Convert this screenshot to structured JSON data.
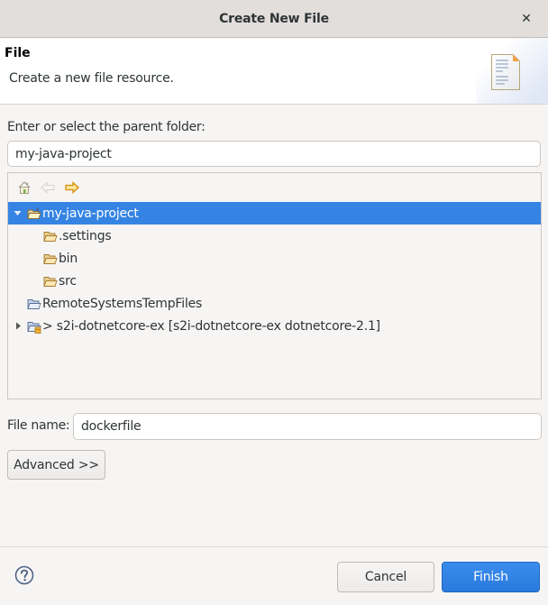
{
  "window": {
    "title": "Create New File",
    "close_icon": "close-icon"
  },
  "banner": {
    "heading": "File",
    "description": "Create a new file resource.",
    "icon": "new-file-icon"
  },
  "parent_folder": {
    "label": "Enter or select the parent folder:",
    "value": "my-java-project"
  },
  "tree_toolbar": {
    "buttons": [
      {
        "name": "home",
        "icon": "home-icon",
        "enabled": true
      },
      {
        "name": "back",
        "icon": "back-arrow-icon",
        "enabled": false
      },
      {
        "name": "forward",
        "icon": "forward-arrow-icon",
        "enabled": true
      }
    ]
  },
  "tree": {
    "items": [
      {
        "label": "my-java-project",
        "level": 0,
        "expanded": true,
        "has_children": true,
        "selected": true,
        "icon": "project-folder-icon"
      },
      {
        "label": ".settings",
        "level": 1,
        "expanded": false,
        "has_children": false,
        "selected": false,
        "icon": "folder-icon"
      },
      {
        "label": "bin",
        "level": 1,
        "expanded": false,
        "has_children": false,
        "selected": false,
        "icon": "folder-icon"
      },
      {
        "label": "src",
        "level": 1,
        "expanded": false,
        "has_children": false,
        "selected": false,
        "icon": "folder-icon"
      },
      {
        "label": "RemoteSystemsTempFiles",
        "level": 0,
        "expanded": false,
        "has_children": false,
        "selected": false,
        "icon": "project-folder-icon"
      },
      {
        "label": "> s2i-dotnetcore-ex [s2i-dotnetcore-ex dotnetcore-2.1]",
        "level": 0,
        "expanded": false,
        "has_children": true,
        "selected": false,
        "icon": "git-project-folder-icon"
      }
    ]
  },
  "file_name": {
    "label": "File name:",
    "value": "dockerfile"
  },
  "buttons": {
    "advanced": "Advanced >>",
    "cancel": "Cancel",
    "finish": "Finish",
    "help_icon": "help-icon"
  },
  "colors": {
    "selection": "#3584e4",
    "primary_button": "#2a79dc"
  }
}
